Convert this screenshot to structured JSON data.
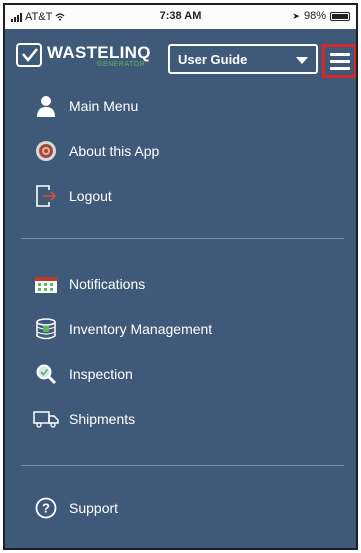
{
  "status_bar": {
    "carrier": "AT&T",
    "time": "7:38 AM",
    "battery": "98%"
  },
  "header": {
    "brand_name": "WASTELINQ",
    "brand_sub": "GENERATOR",
    "dropdown_value": "User Guide",
    "highlight_color": "#d8262c"
  },
  "menu": {
    "group1": [
      {
        "label": "Main Menu",
        "icon": "person-icon"
      },
      {
        "label": "About this App",
        "icon": "target-icon"
      },
      {
        "label": "Logout",
        "icon": "logout-icon"
      }
    ],
    "group2": [
      {
        "label": "Notifications",
        "icon": "calendar-icon"
      },
      {
        "label": "Inventory Management",
        "icon": "barrel-icon"
      },
      {
        "label": "Inspection",
        "icon": "magnifier-icon"
      },
      {
        "label": "Shipments",
        "icon": "truck-icon"
      }
    ],
    "group3": [
      {
        "label": "Support",
        "icon": "help-icon"
      }
    ]
  },
  "colors": {
    "background": "#3f5a78",
    "accent_green": "#5cb85c"
  }
}
